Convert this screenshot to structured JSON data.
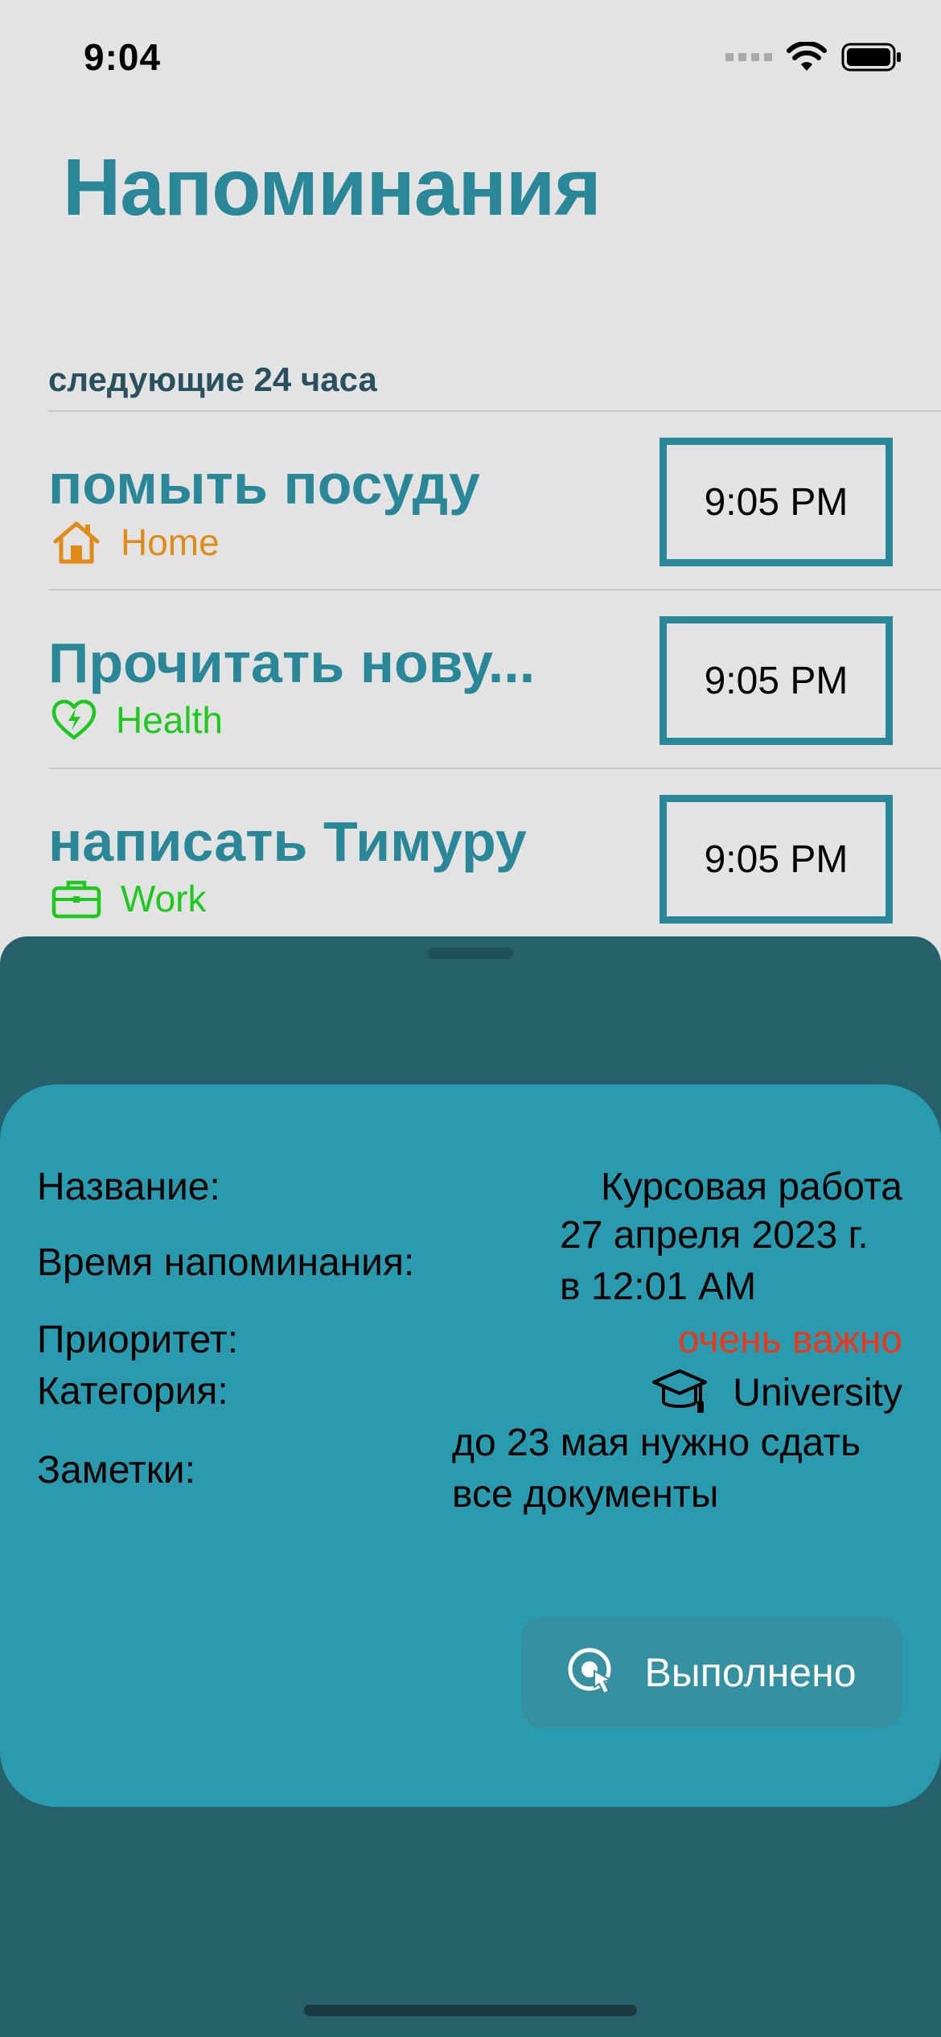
{
  "status_bar": {
    "time": "9:04"
  },
  "header": {
    "title": "Напоминания"
  },
  "section": {
    "label": "следующие 24 часа"
  },
  "reminders": [
    {
      "title": "помыть посуду",
      "category": "Home",
      "category_icon": "house-icon",
      "category_color": "#e08a18",
      "time": "9:05 PM"
    },
    {
      "title": "Прочитать нову...",
      "category": "Health",
      "category_icon": "heart-bolt-icon",
      "category_color": "#1ec81e",
      "time": "9:05 PM"
    },
    {
      "title": "написать Тимуру",
      "category": "Work",
      "category_icon": "briefcase-icon",
      "category_color": "#1ec81e",
      "time": "9:05 PM"
    }
  ],
  "details": {
    "name_label": "Название:",
    "name_value": "Курсовая работа",
    "time_label": "Время напоминания:",
    "time_value_line1": "27 апреля 2023 г.",
    "time_value_line2": "в 12:01 AM",
    "priority_label": "Приоритет:",
    "priority_value": "очень важно",
    "priority_color": "#e8391d",
    "category_label": "Категория:",
    "category_value": "University",
    "category_icon": "graduation-cap-icon",
    "notes_label": "Заметки:",
    "notes_line1": "до 23 мая нужно сдать",
    "notes_line2": "все документы",
    "done_button": "Выполнено",
    "done_icon": "tap-icon"
  },
  "colors": {
    "accent": "#2a8797",
    "sheet": "#26606b",
    "card": "#2a9aaf"
  }
}
